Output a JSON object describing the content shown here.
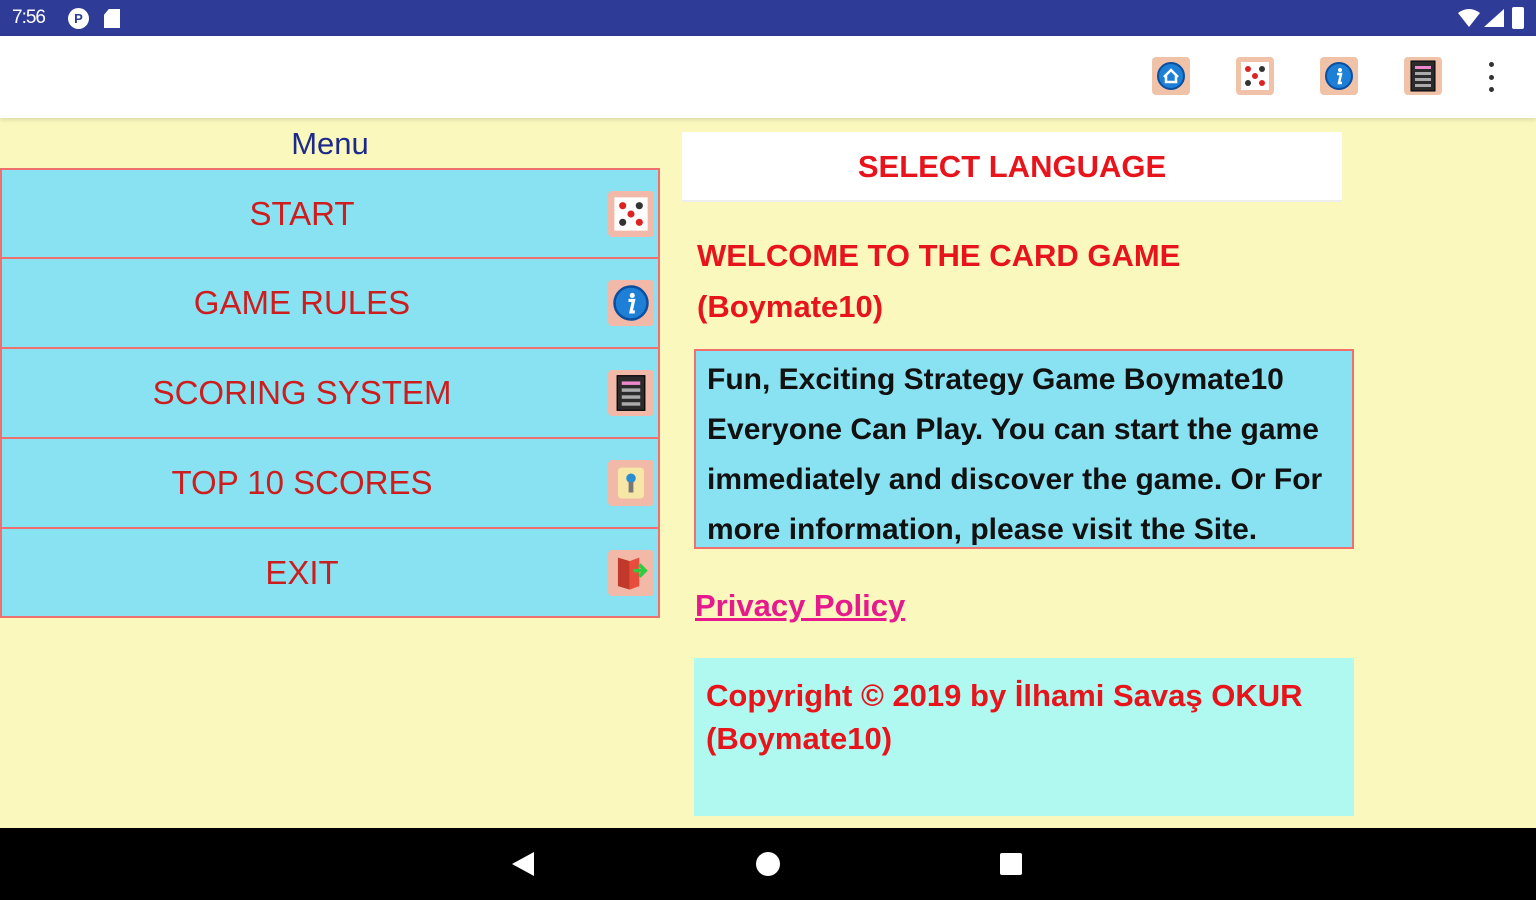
{
  "status_bar": {
    "time": "7:56",
    "p_icon": "P"
  },
  "toolbar": {
    "icons": [
      "home-icon",
      "cards-icon",
      "info-icon",
      "scoreboard-icon",
      "more-vert-icon"
    ]
  },
  "menu": {
    "title": "Menu",
    "items": [
      {
        "label": "START",
        "icon": "cards-icon"
      },
      {
        "label": "GAME RULES",
        "icon": "info-icon"
      },
      {
        "label": "SCORING SYSTEM",
        "icon": "scoreboard-icon"
      },
      {
        "label": "TOP 10 SCORES",
        "icon": "trophy-icon"
      },
      {
        "label": "EXIT",
        "icon": "exit-door-icon"
      }
    ]
  },
  "language": {
    "button_label": "SELECT LANGUAGE"
  },
  "welcome": {
    "line1": "WELCOME TO THE CARD GAME",
    "line2": "(Boymate10)"
  },
  "description": {
    "line1": "Fun, Exciting Strategy Game Boymate10",
    "line2": "Everyone Can Play. You can start the game",
    "line3": "immediately and discover the game. Or For",
    "line4": "more information, please visit the Site."
  },
  "privacy": {
    "link_label": "Privacy Policy"
  },
  "copyright": {
    "line1": "Copyright © 2019 by İlhami Savaş OKUR",
    "line2": "(Boymate10)"
  },
  "colors": {
    "background": "#fbf8bd",
    "status_bar": "#2e3b97",
    "menu_item_bg": "#89e2f1",
    "menu_border": "#f07070",
    "accent_red": "#e8141b",
    "privacy_pink": "#e6198d",
    "copyright_bg": "#aff9f1"
  }
}
